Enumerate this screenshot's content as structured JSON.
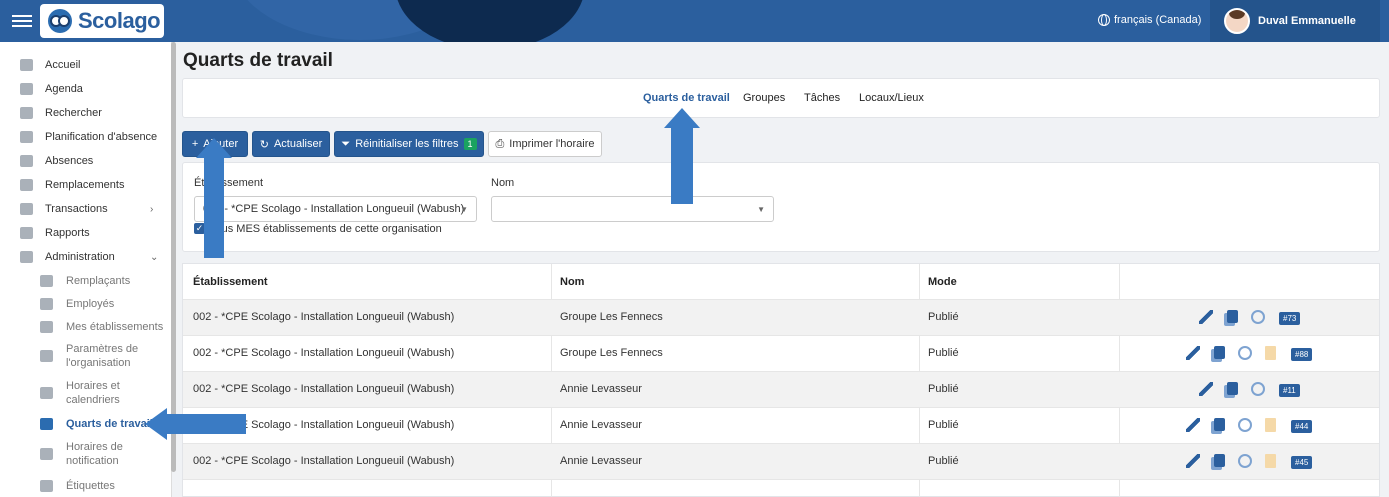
{
  "app": {
    "brand": "Scolago",
    "language": "français (Canada)",
    "user_name": "Duval Emmanuelle"
  },
  "sidebar": {
    "items": [
      {
        "label": "Accueil",
        "icon": "home-icon"
      },
      {
        "label": "Agenda",
        "icon": "calendar-icon"
      },
      {
        "label": "Rechercher",
        "icon": "search-icon"
      },
      {
        "label": "Planification d'absence",
        "icon": "calendar-icon"
      },
      {
        "label": "Absences",
        "icon": "user-clock-icon"
      },
      {
        "label": "Remplacements",
        "icon": "swap-icon"
      },
      {
        "label": "Transactions",
        "icon": "table-icon"
      },
      {
        "label": "Rapports",
        "icon": "file-icon"
      },
      {
        "label": "Administration",
        "icon": "gear-icon"
      }
    ],
    "sub_items": [
      {
        "label": "Remplaçants",
        "icon": "user-icon"
      },
      {
        "label": "Employés",
        "icon": "users-icon"
      },
      {
        "label": "Mes établissements",
        "icon": "building-icon"
      },
      {
        "label_line1": "Paramètres de",
        "label_line2": "l'organisation",
        "icon": "settings-icon"
      },
      {
        "label_line1": "Horaires et",
        "label_line2": "calendriers",
        "icon": "calendar-icon"
      },
      {
        "label": "Quarts de travail",
        "icon": "calendar-edit-icon",
        "active": true
      },
      {
        "label_line1": "Horaires de",
        "label_line2": "notification",
        "icon": "notification-icon"
      },
      {
        "label": "Étiquettes",
        "icon": "tag-icon"
      }
    ]
  },
  "page": {
    "title": "Quarts de travail",
    "tabs": [
      "Quarts de travail",
      "Groupes",
      "Tâches",
      "Locaux/Lieux"
    ],
    "active_tab": 0
  },
  "toolbar": {
    "add_label": "Ajouter",
    "refresh_label": "Actualiser",
    "reset_label": "Réinitialiser les filtres",
    "reset_count": "1",
    "print_label": "Imprimer l'horaire"
  },
  "filters": {
    "establishment_label": "Établissement",
    "establishment_value": "002 - *CPE Scolago - Installation Longueuil (Wabush)",
    "name_label": "Nom",
    "name_value": "",
    "checkbox_label": "Tous MES établissements de cette organisation",
    "checkbox_checked": true
  },
  "table": {
    "columns": [
      "Établissement",
      "Nom",
      "Mode",
      ""
    ],
    "rows": [
      {
        "etab": "002 - *CPE Scolago - Installation Longueuil (Wabush)",
        "nom": "Groupe Les Fennecs",
        "mode": "Publié",
        "id": "#73",
        "trash": false
      },
      {
        "etab": "002 - *CPE Scolago - Installation Longueuil (Wabush)",
        "nom": "Groupe Les Fennecs",
        "mode": "Publié",
        "id": "#88",
        "trash": true
      },
      {
        "etab": "002 - *CPE Scolago - Installation Longueuil (Wabush)",
        "nom": "Annie Levasseur",
        "mode": "Publié",
        "id": "#11",
        "trash": false
      },
      {
        "etab": "002 - *CPE Scolago - Installation Longueuil (Wabush)",
        "nom": "Annie Levasseur",
        "mode": "Publié",
        "id": "#44",
        "trash": true
      },
      {
        "etab": "002 - *CPE Scolago - Installation Longueuil (Wabush)",
        "nom": "Annie Levasseur",
        "mode": "Publié",
        "id": "#45",
        "trash": true
      }
    ]
  },
  "colors": {
    "primary": "#2b5f9e",
    "topbar": "#2b5f9e",
    "success_badge": "#1aa260",
    "annotation_arrow": "#3a7bc4"
  }
}
